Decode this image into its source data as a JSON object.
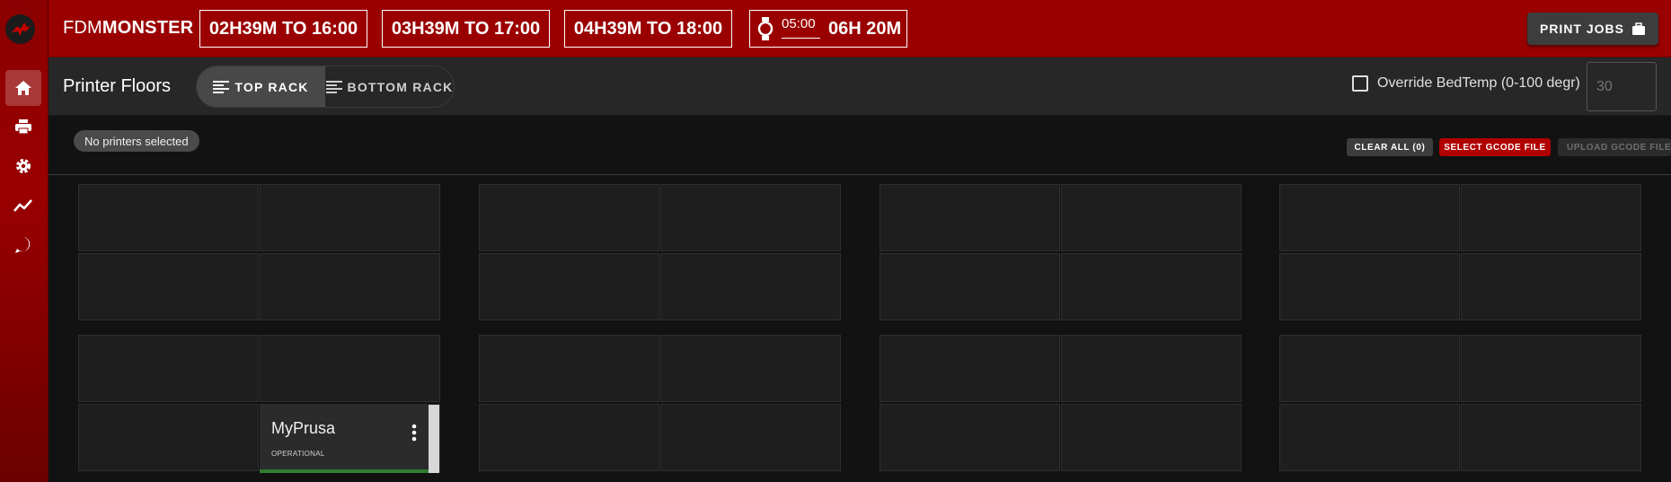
{
  "brand": {
    "prefix": "FDM",
    "name": "MONSTER"
  },
  "shifts": [
    {
      "label": "02H39M TO 16:00"
    },
    {
      "label": "03H39M TO 17:00"
    },
    {
      "label": "04H39M TO 18:00"
    }
  ],
  "cutoff": {
    "time": "05:00",
    "remaining": "06H 20M"
  },
  "print_jobs_label": "PRINT JOBS",
  "sidebar": {
    "items": [
      {
        "icon": "home-icon",
        "active": true
      },
      {
        "icon": "printer-icon",
        "active": false
      },
      {
        "icon": "gear-icon",
        "active": false
      },
      {
        "icon": "chart-line-icon",
        "active": false
      },
      {
        "icon": "help-icon",
        "active": false
      }
    ]
  },
  "floorbar": {
    "title": "Printer Floors",
    "floors": [
      {
        "label": "TOP RACK",
        "active": true
      },
      {
        "label": "BOTTOM RACK",
        "active": false
      }
    ],
    "override_label": "Override BedTemp (0-100 degr)",
    "override_checked": false,
    "bedtemp_placeholder": "30"
  },
  "selection": {
    "chip": "No printers selected",
    "clear_label": "CLEAR ALL (0)",
    "select_label": "SELECT GCODE FILE",
    "upload_label": "UPLOAD GCODE FILE"
  },
  "printers": [
    {
      "name": "MyPrusa",
      "state": "OPERATIONAL"
    }
  ],
  "colors": {
    "accent": "#9a0000",
    "operational": "#2e7d32"
  }
}
